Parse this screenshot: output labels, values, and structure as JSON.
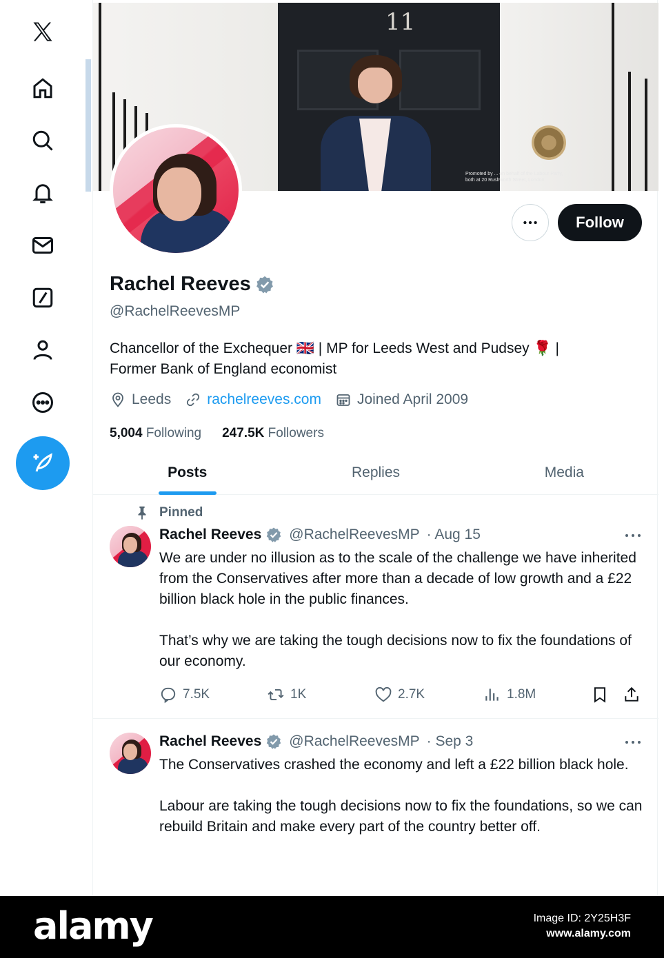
{
  "nav": {
    "icons": [
      "x-logo-icon",
      "home-icon",
      "search-icon",
      "bell-icon",
      "mail-icon",
      "grok-icon",
      "profile-icon",
      "more-icon"
    ],
    "compose_icon": "compose-icon",
    "accent": "#1d9bf0"
  },
  "banner": {
    "door_number": "11",
    "promo_line1": "Promoted by ... on behalf of the Labour Party,",
    "promo_line2": "both at 20 Rushworth Street, London"
  },
  "profile": {
    "display_name": "Rachel Reeves",
    "handle": "@RachelReevesMP",
    "bio_line1": "Chancellor of the Exchequer 🇬🇧 | MP for Leeds West and Pudsey 🌹 |",
    "bio_line2": "Former Bank of England economist",
    "location": "Leeds",
    "website": "rachelreeves.com",
    "joined": "Joined April 2009",
    "following_count": "5,004",
    "following_label": "Following",
    "followers_count": "247.5K",
    "followers_label": "Followers",
    "follow_button": "Follow"
  },
  "tabs": [
    "Posts",
    "Replies",
    "Media"
  ],
  "posts": [
    {
      "pinned_label": "Pinned",
      "name": "Rachel Reeves",
      "handle": "@RachelReevesMP",
      "date": "· Aug 15",
      "para1": "We are under no illusion as to the scale of the challenge we have inherited from the Conservatives after more than a decade of low growth and a £22 billion black hole in the public finances.",
      "para2": "That’s why we are taking the tough decisions now to fix the foundations of our economy.",
      "replies": "7.5K",
      "reposts": "1K",
      "likes": "2.7K",
      "views": "1.8M"
    },
    {
      "name": "Rachel Reeves",
      "handle": "@RachelReevesMP",
      "date": "· Sep 3",
      "para1": "The Conservatives crashed the economy and left a £22 billion black hole.",
      "para2": "Labour are taking the tough decisions now to fix the foundations, so we can rebuild Britain and make every part of the country better off."
    }
  ],
  "footer": {
    "logo": "alamy",
    "image_id": "Image ID: 2Y25H3F",
    "site": "www.alamy.com"
  }
}
